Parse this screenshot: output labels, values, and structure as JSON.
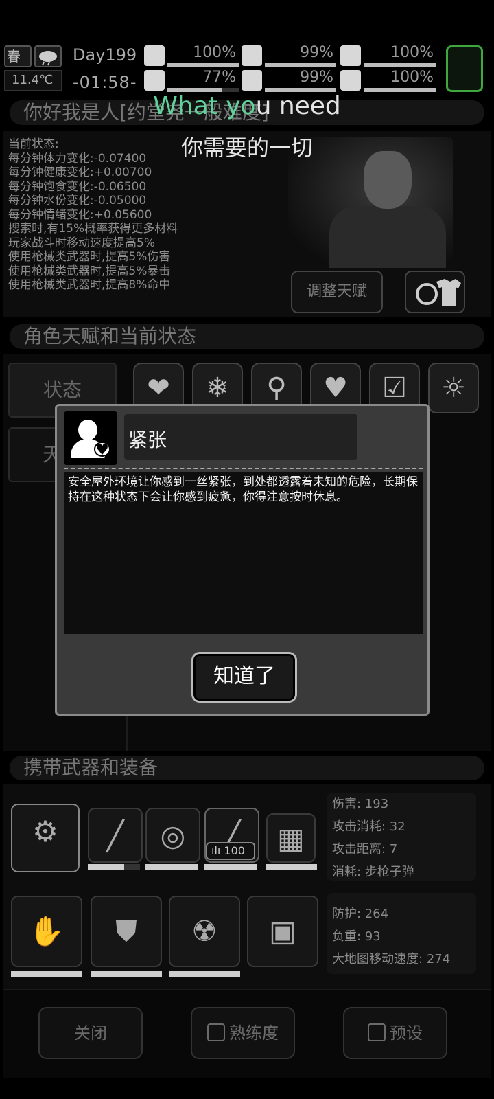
{
  "topbar": {
    "season": "春",
    "temperature": "11.4℃",
    "day": "Day199",
    "clock": "-01:58-",
    "stats": [
      {
        "name": "medical",
        "value": "100%",
        "level": 1.0
      },
      {
        "name": "food",
        "value": "99%",
        "level": 0.99
      },
      {
        "name": "mood",
        "value": "100%",
        "level": 1.0
      },
      {
        "name": "stamina",
        "value": "77%",
        "level": 0.77
      },
      {
        "name": "water",
        "value": "99%",
        "level": 0.99
      },
      {
        "name": "health",
        "value": "100%",
        "level": 1.0
      }
    ]
  },
  "caption": {
    "line1_green": "What yo",
    "line1_rest": "u need",
    "line2": "你需要的一切"
  },
  "character": {
    "title": "你好我是人[约堂尧一般难度]",
    "status_lines": [
      "当前状态:",
      "每分钟体力变化:-0.07400",
      "每分钟健康变化:+0.00700",
      "每分钟饱食变化:-0.06500",
      "每分钟水份变化:-0.05000",
      "每分钟情绪变化:+0.05600",
      "搜索时,有15%概率获得更多材料",
      "玩家战斗时移动速度提高5%",
      "使用枪械类武器时,提高5%伤害",
      "使用枪械类武器时,提高5%暴击",
      "使用枪械类武器时,提高8%命中"
    ],
    "adjust_talent_label": "调整天赋"
  },
  "talents": {
    "title": "角色天赋和当前状态",
    "tab_status": "状态",
    "tab_talent": "天",
    "slot_icons": [
      "heart-icon",
      "snowflake-icon",
      "stomach-icon",
      "heart-music-icon",
      "clipboard-pill-icon",
      "alarm-person-icon"
    ]
  },
  "modal": {
    "title": "紧张",
    "body": "安全屋外环境让你感到一丝紧张，到处都透露着未知的危险，长期保持在这种状态下会让你感到疲惫，你得注意按时休息。",
    "ok_label": "知道了"
  },
  "equipment": {
    "title": "携带武器和装备",
    "weapon_stats": [
      "伤害: 193",
      "攻击消耗: 32",
      "攻击距离: 7",
      "消耗: 步枪子弹"
    ],
    "armor_stats": [
      "防护: 264",
      "负重: 93",
      "大地图移动速度: 274"
    ],
    "ammo_count": "100",
    "weapon_durability": [
      1.0,
      0.7,
      1.0,
      1.0,
      1.0
    ],
    "armor_durability": [
      1.0,
      1.0,
      1.0
    ]
  },
  "bottom": {
    "close_label": "关闭",
    "proficiency_label": "熟练度",
    "preset_label": "预设"
  }
}
